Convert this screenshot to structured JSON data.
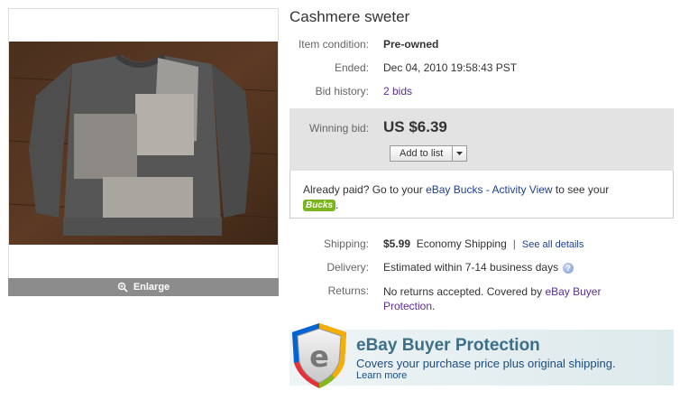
{
  "item": {
    "title": "Cashmere sweter",
    "enlarge_label": "Enlarge",
    "condition_label": "Item condition:",
    "condition_value": "Pre-owned",
    "ended_label": "Ended:",
    "ended_value": "Dec 04, 2010 19:58:43 PST",
    "bid_history_label": "Bid history:",
    "bid_history_value": "2 bids"
  },
  "bid": {
    "winning_label": "Winning bid:",
    "winning_price": "US $6.39",
    "add_to_list_label": "Add to list"
  },
  "paid": {
    "text_before": "Already paid? Go to your ",
    "link": "eBay Bucks - Activity View",
    "text_after": " to see your",
    "bucks_logo": "Bucks",
    "period": "."
  },
  "shipping": {
    "shipping_label": "Shipping:",
    "shipping_price": "$5.99",
    "shipping_method": "Economy Shipping",
    "separator": "|",
    "see_details": "See all details",
    "delivery_label": "Delivery:",
    "delivery_value": "Estimated within 7-14 business days",
    "help_icon": "?",
    "returns_label": "Returns:",
    "returns_text": "No returns accepted. Covered by ",
    "returns_link_1": "eBay Buyer",
    "returns_link_2": "Protection",
    "returns_period": "."
  },
  "protection": {
    "title": "eBay Buyer Protection",
    "subtitle": "Covers your purchase price plus original shipping.",
    "learn_more": "Learn more",
    "shield_letter": "e"
  },
  "colors": {
    "link_purple": "#5a2f94",
    "link_blue": "#1f3f8f",
    "bucks_green": "#7ab51d",
    "bid_box_bg": "#e3e3e3",
    "banner_title": "#3d6f88"
  }
}
